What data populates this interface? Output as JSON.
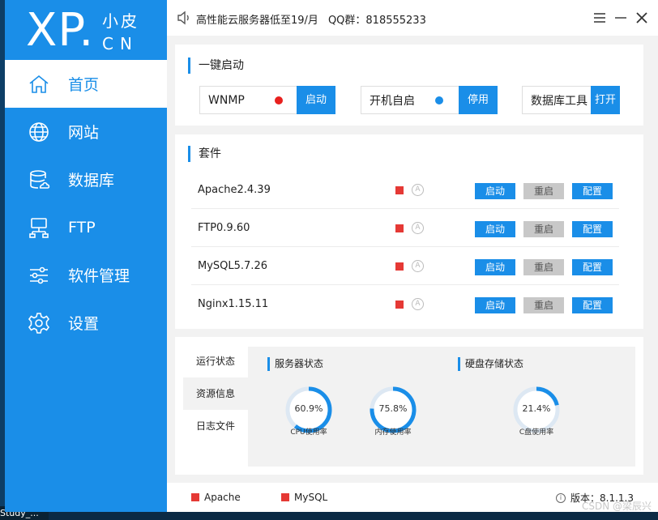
{
  "desktop": {
    "taskbar_label": "Study_..."
  },
  "logo": {
    "xp": "XP.",
    "cn_top": "小皮",
    "cn_bottom": "CN"
  },
  "sidebar": {
    "items": [
      {
        "label": "首页",
        "icon": "home-icon",
        "active": true
      },
      {
        "label": "网站",
        "icon": "globe-icon"
      },
      {
        "label": "数据库",
        "icon": "database-icon"
      },
      {
        "label": "FTP",
        "icon": "ftp-icon"
      },
      {
        "label": "软件管理",
        "icon": "sliders-icon"
      },
      {
        "label": "设置",
        "icon": "gear-icon"
      }
    ]
  },
  "header": {
    "notice": "高性能云服务器低至19/月",
    "qq": "QQ群：818555233",
    "menu_icon": "menu-icon",
    "minimize_icon": "minimize-icon",
    "close_icon": "close-icon"
  },
  "quick_start": {
    "title": "一键启动",
    "items": [
      {
        "label": "WNMP",
        "button": "启动",
        "dot_color": "#e8201e"
      },
      {
        "label": "开机自启",
        "button": "停用",
        "dot_color": "#1a8ee8"
      },
      {
        "label": "数据库工具",
        "button": "打开"
      }
    ]
  },
  "suite": {
    "title": "套件",
    "auto_glyph": "A",
    "rows": [
      {
        "name": "Apache2.4.39",
        "start": "启动",
        "restart": "重启",
        "config": "配置"
      },
      {
        "name": "FTP0.9.60",
        "start": "启动",
        "restart": "重启",
        "config": "配置"
      },
      {
        "name": "MySQL5.7.26",
        "start": "启动",
        "restart": "重启",
        "config": "配置"
      },
      {
        "name": "Nginx1.15.11",
        "start": "启动",
        "restart": "重启",
        "config": "配置"
      }
    ]
  },
  "status": {
    "tabs": [
      "运行状态",
      "资源信息",
      "日志文件"
    ],
    "active_tab": 1,
    "server_title": "服务器状态",
    "disk_title": "硬盘存储状态",
    "gauges": [
      {
        "value_text": "60.9%",
        "value": 60.9,
        "label": "CPU使用率"
      },
      {
        "value_text": "75.8%",
        "value": 75.8,
        "label": "内存使用率"
      },
      {
        "value_text": "21.4%",
        "value": 21.4,
        "label": "C盘使用率"
      }
    ]
  },
  "footer": {
    "items": [
      "Apache",
      "MySQL"
    ],
    "version": "版本：8.1.1.3",
    "watermark": "CSDN @梁辰兴"
  },
  "colors": {
    "accent": "#1a8ee8",
    "status_red": "#e53935",
    "button_grey": "#c8c8c8",
    "gauge_track": "#dde8f3"
  }
}
